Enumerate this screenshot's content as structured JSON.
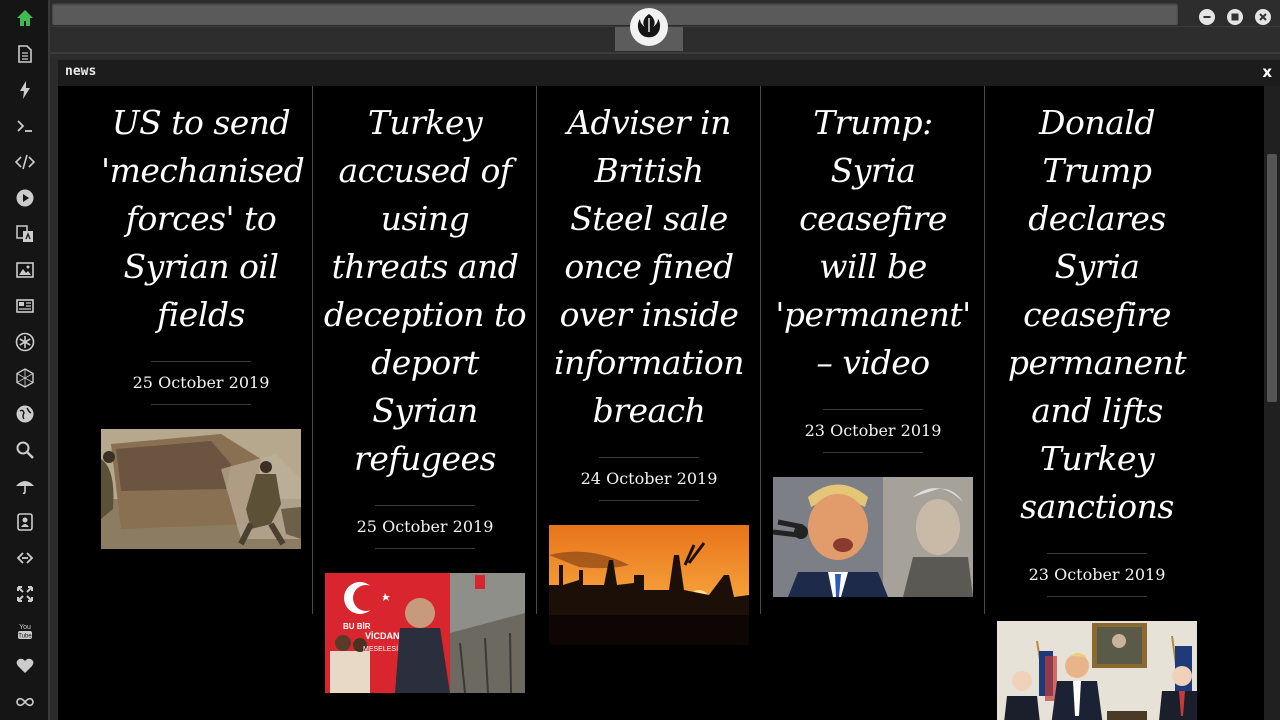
{
  "window": {
    "panel_title": "news",
    "close_label": "x"
  },
  "sidebar": {
    "icons": [
      "home-icon",
      "document-icon",
      "lightning-icon",
      "terminal-icon",
      "code-icon",
      "play-icon",
      "translate-icon",
      "image-icon",
      "newspaper-icon",
      "gear-star-icon",
      "hexagon-icon",
      "globe-icon",
      "search-icon",
      "umbrella-icon",
      "contact-icon",
      "link-icon",
      "expand-icon",
      "youtube-icon",
      "heart-icon",
      "infinity-icon"
    ],
    "accent": "#3fb950"
  },
  "articles": [
    {
      "headline": "US to send 'mechanised forces' to Syrian oil fields",
      "date": "25 October 2019",
      "image": "armored-vehicle-soldiers"
    },
    {
      "headline": "Turkey accused of using threats and deception to deport Syrian refugees",
      "date": "25 October 2019",
      "image": "erdogan-billboard"
    },
    {
      "headline": "Adviser in British Steel sale once fined over inside information breach",
      "date": "24 October 2019",
      "image": "steelworks-sunset"
    },
    {
      "headline": "Trump: Syria ceasefire will be 'permanent' – video",
      "date": "23 October 2019",
      "image": "trump-speaking"
    },
    {
      "headline": "Donald Trump declares Syria ceasefire permanent and lifts Turkey sanctions",
      "date": "23 October 2019",
      "image": "trump-press-room"
    }
  ],
  "poster_text": {
    "line1": "BU BİR",
    "line2": "VİCDAN",
    "line3": "MESELESİ"
  }
}
